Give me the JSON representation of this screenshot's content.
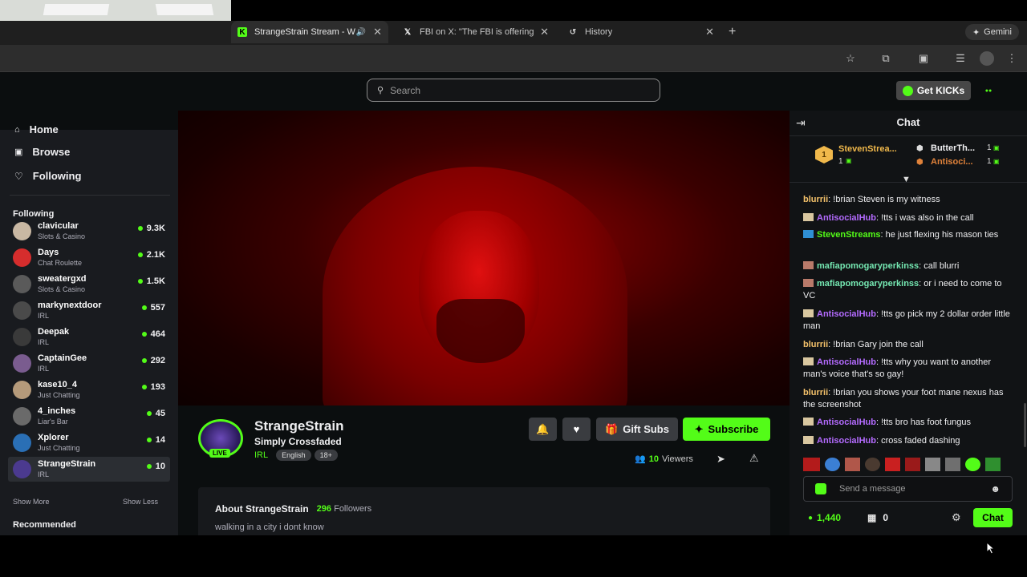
{
  "browser": {
    "tabs": [
      {
        "title": "StrangeStrain Stream - W",
        "active": true
      },
      {
        "title": "FBI on X: \"The FBI is offering",
        "active": false
      },
      {
        "title": "History",
        "active": false
      }
    ],
    "gemini_label": "Gemini",
    "new_tab": "+"
  },
  "header": {
    "search_placeholder": "Search",
    "get_kicks": "Get KICKs"
  },
  "sidebar": {
    "nav": [
      {
        "label": "Home"
      },
      {
        "label": "Browse"
      },
      {
        "label": "Following"
      }
    ],
    "following_heading": "Following",
    "channels": [
      {
        "name": "clavicular",
        "category": "Slots & Casino",
        "viewers": "9.3K",
        "avatar_color": "#c9b8a3"
      },
      {
        "name": "Days",
        "category": "Chat Roulette",
        "viewers": "2.1K",
        "avatar_color": "#d62d2d"
      },
      {
        "name": "sweatergxd",
        "category": "Slots & Casino",
        "viewers": "1.5K",
        "avatar_color": "#5a5a5a"
      },
      {
        "name": "markynextdoor",
        "category": "IRL",
        "viewers": "557",
        "avatar_color": "#4a4a4a"
      },
      {
        "name": "Deepak",
        "category": "IRL",
        "viewers": "464",
        "avatar_color": "#3a3a3a"
      },
      {
        "name": "CaptainGee",
        "category": "IRL",
        "viewers": "292",
        "avatar_color": "#7a5c8f"
      },
      {
        "name": "kase10_4",
        "category": "Just Chatting",
        "viewers": "193",
        "avatar_color": "#b59a7a"
      },
      {
        "name": "4_inches",
        "category": "Liar's Bar",
        "viewers": "45",
        "avatar_color": "#6a6a6a"
      },
      {
        "name": "Xplorer",
        "category": "Just Chatting",
        "viewers": "14",
        "avatar_color": "#2a6fb5"
      },
      {
        "name": "StrangeStrain",
        "category": "IRL",
        "viewers": "10",
        "avatar_color": "#4b3a8f"
      }
    ],
    "show_more": "Show More",
    "show_less": "Show Less",
    "recommended_heading": "Recommended"
  },
  "stream": {
    "channel_name": "StrangeStrain",
    "title": "Simply Crossfaded",
    "category": "IRL",
    "tags": [
      "English",
      "18+"
    ],
    "live_badge": "LIVE",
    "gift_subs": "Gift Subs",
    "subscribe": "Subscribe",
    "viewers_count": "10",
    "viewers_label": "Viewers",
    "about_title": "About StrangeStrain",
    "followers_count": "296",
    "followers_label": "Followers",
    "bio": "walking in a city i dont know"
  },
  "chat": {
    "title": "Chat",
    "leaderboard": [
      {
        "name": "StevenStrea...",
        "count": "1",
        "rank": "1"
      },
      {
        "name": "ButterTh...",
        "count": "1"
      },
      {
        "name": "Antisoci...",
        "count": "1"
      }
    ],
    "messages": [
      {
        "user": "blurrii",
        "text": "!brian Steven is my witness",
        "color": "#f5c26b"
      },
      {
        "user": "AntisocialHub",
        "text": "!tts i was also in the call",
        "color": "#b46bff"
      },
      {
        "user": "StevenStreams",
        "text": "he just flexing his mason ties",
        "color": "#53fc18"
      },
      {
        "user": "mafiapomogaryperkinss",
        "text": "call blurri",
        "color": "#75e8b2"
      },
      {
        "user": "mafiapomogaryperkinss",
        "text": "or i need to come to VC",
        "color": "#75e8b2"
      },
      {
        "user": "AntisocialHub",
        "text": "!tts go pick my 2 dollar order little man",
        "color": "#b46bff"
      },
      {
        "user": "blurrii",
        "text": "!brian Gary join the call",
        "color": "#f5c26b"
      },
      {
        "user": "AntisocialHub",
        "text": "!tts why you want to another man's voice that's so gay!",
        "color": "#b46bff"
      },
      {
        "user": "blurrii",
        "text": "!brian you shows your foot mane nexus has the screenshot",
        "color": "#f5c26b"
      },
      {
        "user": "AntisocialHub",
        "text": "!tts bro has foot fungus",
        "color": "#b46bff"
      },
      {
        "user": "AntisocialHub",
        "text": "cross faded dashing",
        "color": "#b46bff"
      }
    ],
    "input_placeholder": "Send a message",
    "kicks_balance": "1,440",
    "store_count": "0",
    "chat_button": "Chat"
  },
  "colors": {
    "accent": "#53fc18",
    "page_bg": "#0b0e0f",
    "sidebar_bg": "#191b1f"
  }
}
